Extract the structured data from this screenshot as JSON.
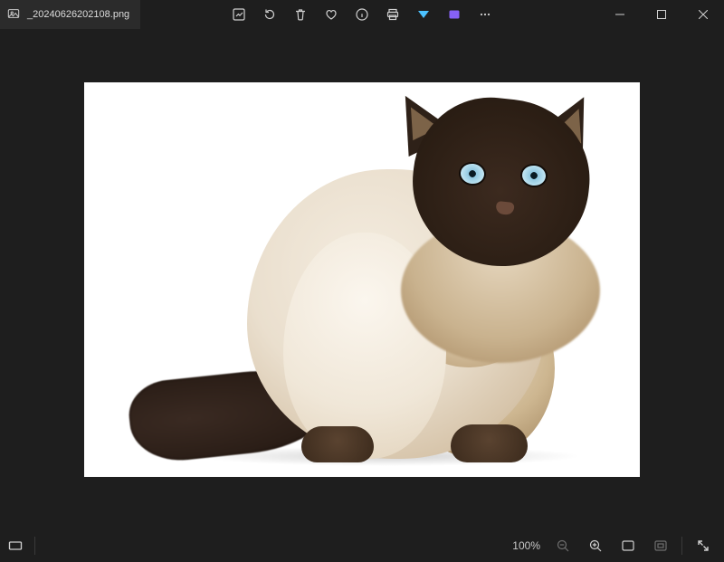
{
  "titlebar": {
    "filename": "_20240626202108.png"
  },
  "toolbar": {
    "edit": "Edit image",
    "rotate": "Rotate",
    "delete": "Delete",
    "favorite": "Add to favorites",
    "info": "Image info",
    "print": "Print",
    "visual_search": "Visual Search",
    "clipchamp": "Edit with Clipchamp",
    "more": "See more"
  },
  "window": {
    "minimize": "Minimize",
    "maximize": "Maximize",
    "close": "Close"
  },
  "status": {
    "filmstrip": "Filmstrip",
    "zoom_level": "100%",
    "zoom_out": "Zoom out",
    "zoom_in": "Zoom in",
    "fit": "Zoom to fit",
    "actual": "View actual size",
    "fullscreen": "Full screen"
  }
}
